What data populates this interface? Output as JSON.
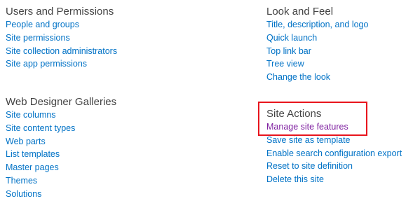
{
  "users_permissions": {
    "title": "Users and Permissions",
    "links": [
      "People and groups",
      "Site permissions",
      "Site collection administrators",
      "Site app permissions"
    ]
  },
  "look_and_feel": {
    "title": "Look and Feel",
    "links": [
      "Title, description, and logo",
      "Quick launch",
      "Top link bar",
      "Tree view",
      "Change the look"
    ]
  },
  "web_designer_galleries": {
    "title": "Web Designer Galleries",
    "links": [
      "Site columns",
      "Site content types",
      "Web parts",
      "List templates",
      "Master pages",
      "Themes",
      "Solutions"
    ]
  },
  "site_actions": {
    "title": "Site Actions",
    "links": [
      "Manage site features",
      "Save site as template",
      "Enable search configuration export",
      "Reset to site definition",
      "Delete this site"
    ]
  },
  "colors": {
    "link": "#0072c6",
    "visited_link": "#7f1fa0",
    "heading": "#444444",
    "highlight": "#e8151d"
  }
}
